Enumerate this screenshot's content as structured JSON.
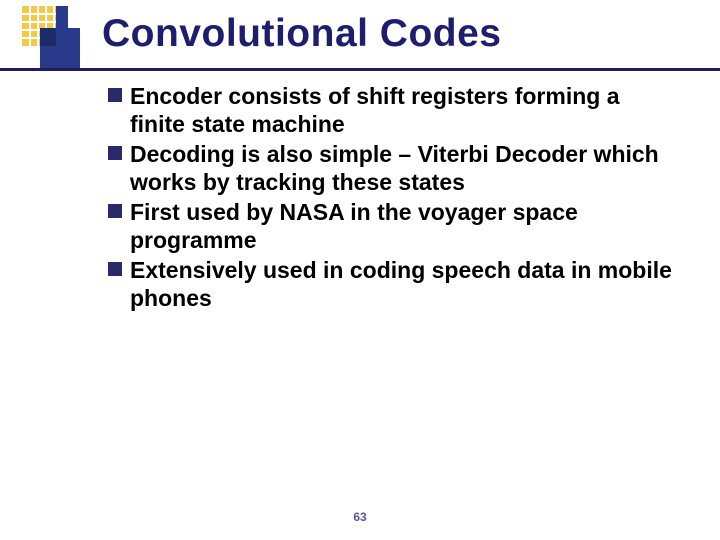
{
  "title": "Convolutional Codes",
  "bullets": [
    "Encoder consists of shift registers forming a finite state machine",
    "Decoding is also simple – Viterbi Decoder which works by tracking these states",
    "First used by NASA in the voyager space programme",
    "Extensively used in coding speech data in mobile phones"
  ],
  "page_number": "63"
}
